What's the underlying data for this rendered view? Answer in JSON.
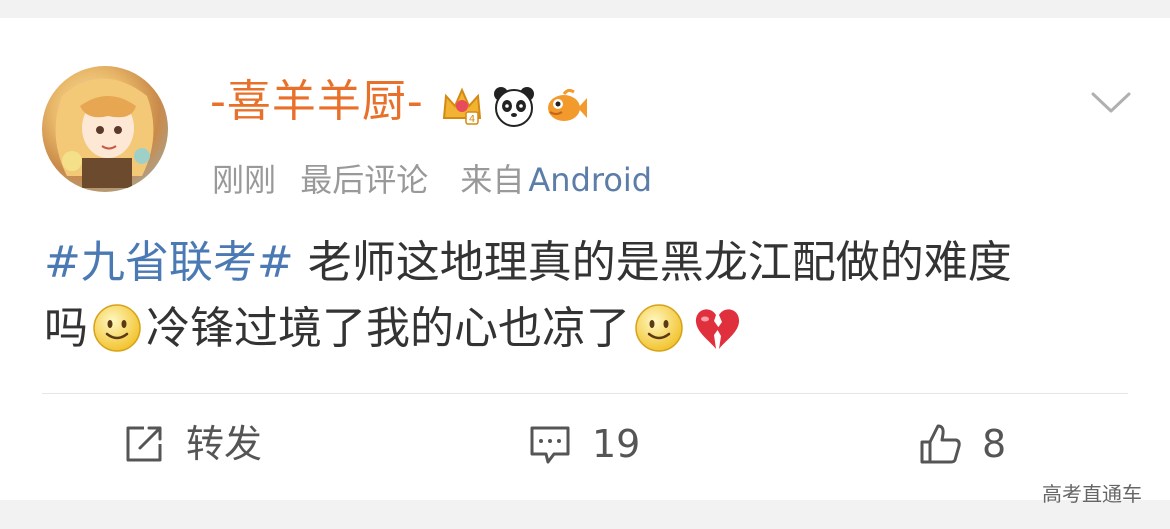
{
  "post": {
    "username": "-喜羊羊厨-",
    "badges": [
      "crown-badge-icon",
      "panda-badge-icon",
      "fish-badge-icon"
    ],
    "meta": {
      "time": "刚刚",
      "status": "最后评论",
      "source_prefix": "来自",
      "source": "Android"
    },
    "content": {
      "hashtag": "#九省联考#",
      "line1": " 老师这地理真的是黑龙江配做的难度",
      "line2_a": "吗",
      "line2_b": "冷锋过境了我的心也凉了"
    }
  },
  "actions": {
    "repost_label": "转发",
    "comment_count": "19",
    "like_count": "8"
  },
  "watermark": "高考直通车",
  "colors": {
    "username": "#e8702a",
    "hashtag": "#4a79b3",
    "source": "#5b7da8"
  }
}
